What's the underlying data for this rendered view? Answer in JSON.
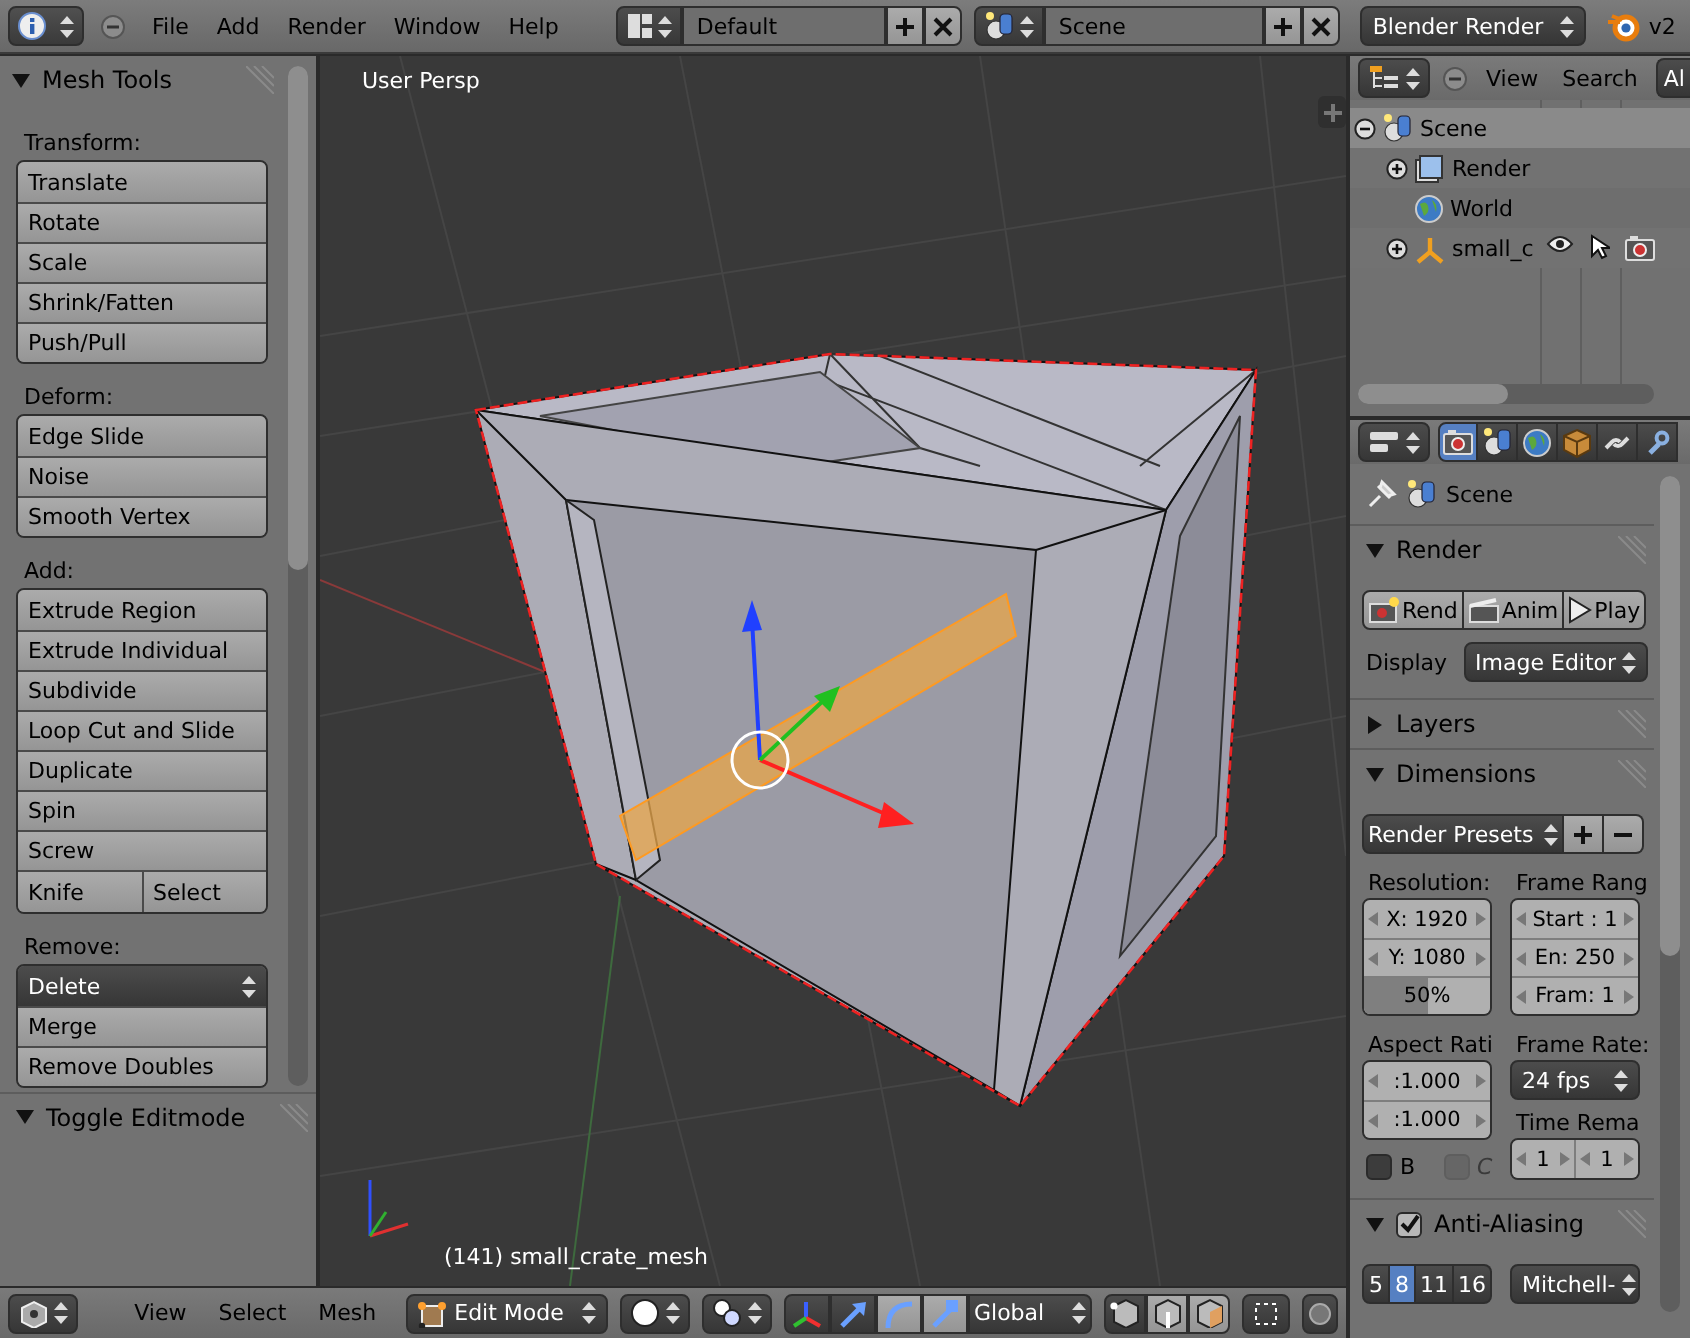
{
  "topbar": {
    "menus": [
      "File",
      "Add",
      "Render",
      "Window",
      "Help"
    ],
    "screen_layout": "Default",
    "scene": "Scene",
    "render_engine": "Blender Render",
    "version": "v2"
  },
  "tool_shelf": {
    "panels": [
      {
        "title": "Mesh Tools",
        "expanded": true,
        "groups": [
          {
            "label": "Transform:",
            "rows": [
              {
                "kind": "button",
                "labels": [
                  "Translate"
                ]
              },
              {
                "kind": "button",
                "labels": [
                  "Rotate"
                ]
              },
              {
                "kind": "button",
                "labels": [
                  "Scale"
                ]
              },
              {
                "kind": "button",
                "labels": [
                  "Shrink/Fatten"
                ]
              },
              {
                "kind": "button",
                "labels": [
                  "Push/Pull"
                ]
              }
            ]
          },
          {
            "label": "Deform:",
            "rows": [
              {
                "kind": "button",
                "labels": [
                  "Edge Slide"
                ]
              },
              {
                "kind": "button",
                "labels": [
                  "Noise"
                ]
              },
              {
                "kind": "button",
                "labels": [
                  "Smooth Vertex"
                ]
              }
            ]
          },
          {
            "label": "Add:",
            "rows": [
              {
                "kind": "button",
                "labels": [
                  "Extrude Region"
                ]
              },
              {
                "kind": "button",
                "labels": [
                  "Extrude Individual"
                ]
              },
              {
                "kind": "button",
                "labels": [
                  "Subdivide"
                ]
              },
              {
                "kind": "button",
                "labels": [
                  "Loop Cut and Slide"
                ]
              },
              {
                "kind": "button",
                "labels": [
                  "Duplicate"
                ]
              },
              {
                "kind": "button",
                "labels": [
                  "Spin"
                ]
              },
              {
                "kind": "button",
                "labels": [
                  "Screw"
                ]
              },
              {
                "kind": "button",
                "labels": [
                  "Knife",
                  "Select"
                ]
              }
            ]
          },
          {
            "label": "Remove:",
            "rows": [
              {
                "kind": "dropdown",
                "labels": [
                  "Delete"
                ]
              },
              {
                "kind": "button",
                "labels": [
                  "Merge"
                ]
              },
              {
                "kind": "button",
                "labels": [
                  "Remove Doubles"
                ]
              }
            ]
          }
        ]
      },
      {
        "title": "Toggle Editmode",
        "expanded": true
      }
    ]
  },
  "viewport": {
    "view_name": "User Persp",
    "object_info": "(141) small_crate_mesh"
  },
  "view_header": {
    "menus": [
      "View",
      "Select",
      "Mesh"
    ],
    "mode": "Edit Mode",
    "orientation": "Global"
  },
  "outliner": {
    "menus": [
      "View",
      "Search"
    ],
    "filter": "Al",
    "tree": [
      {
        "label": "Scene",
        "kind": "scene",
        "selected": true,
        "expanded": true,
        "children": [
          {
            "label": "Render",
            "kind": "render",
            "selected": false,
            "expanded": false
          },
          {
            "label": "World",
            "kind": "world",
            "selected": false
          },
          {
            "label": "small_c",
            "kind": "object",
            "selected": false,
            "expanded": false
          }
        ]
      }
    ]
  },
  "properties": {
    "tabs": [
      {
        "kind": "render",
        "selected": true
      },
      {
        "kind": "scene",
        "selected": false
      },
      {
        "kind": "world",
        "selected": false
      },
      {
        "kind": "object",
        "selected": false
      },
      {
        "kind": "constraints",
        "selected": false
      },
      {
        "kind": "modifiers",
        "selected": false
      }
    ],
    "context": "Scene",
    "render": {
      "title": "Render",
      "expanded": true,
      "buttons": [
        "Rend",
        "Anim",
        "Play"
      ],
      "display_label": "Display",
      "display": "Image Editor"
    },
    "layers": {
      "title": "Layers",
      "expanded": false
    },
    "dimensions": {
      "title": "Dimensions",
      "expanded": true,
      "presets": "Render Presets",
      "resolution_label": "Resolution:",
      "resolution_x": "X: 1920",
      "resolution_y": "Y: 1080",
      "percentage": {
        "text": "50%",
        "level": 0.5
      },
      "aspect_label": "Aspect Rati",
      "aspect_x": ":1.000",
      "aspect_y": ":1.000",
      "border": {
        "label": "B",
        "checked": false,
        "disabled": false
      },
      "crop": {
        "label": "C",
        "checked": false,
        "disabled": true
      },
      "frame_range_label": "Frame Rang",
      "frame_start": "Start : 1",
      "frame_end": "En: 250",
      "frame_step": "Fram: 1",
      "frame_rate_label": "Frame Rate:",
      "frame_rate": "24 fps",
      "time_remap_label": "Time Rema",
      "time_remap": [
        "1",
        "1"
      ]
    },
    "anti_aliasing": {
      "title": "Anti-Aliasing",
      "expanded": true,
      "enabled": true,
      "samples": [
        {
          "label": "5",
          "selected": false
        },
        {
          "label": "8",
          "selected": true
        },
        {
          "label": "11",
          "selected": false
        },
        {
          "label": "16",
          "selected": false
        }
      ],
      "filter": "Mitchell-"
    }
  }
}
